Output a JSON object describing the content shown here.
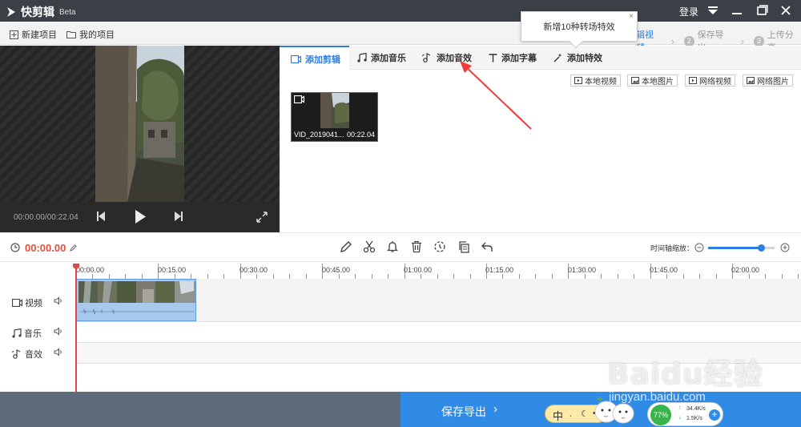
{
  "app": {
    "title": "快剪辑",
    "beta": "Beta",
    "login": "登录"
  },
  "menubar": {
    "new_project": "新建项目",
    "my_projects": "我的项目"
  },
  "steps": [
    {
      "num": "",
      "label": "辑视频"
    },
    {
      "num": "2",
      "label": "保存导出"
    },
    {
      "num": "3",
      "label": "上传分享"
    }
  ],
  "tooltip": {
    "text": "新增10种转场特效",
    "close": "×"
  },
  "preview": {
    "time": "00:00.00/00:22.04"
  },
  "tabs": [
    "添加剪辑",
    "添加音乐",
    "添加音效",
    "添加字幕",
    "添加特效"
  ],
  "sources": [
    "本地视频",
    "本地图片",
    "网络视频",
    "网络图片"
  ],
  "media": {
    "name": "VID_2019041...",
    "duration": "00:22.04"
  },
  "toolbar": {
    "current_time": "00:00.00",
    "zoom_label": "时间轴缩放：",
    "zoom_level": 0.8
  },
  "ruler": [
    "00:00.00",
    "00:15.00",
    "00:30.00",
    "00:45.00",
    "01:00.00",
    "01:15.00",
    "01:30.00",
    "01:45.00",
    "02:00.00"
  ],
  "tracks": [
    "视频",
    "音乐",
    "音效"
  ],
  "export": {
    "label": "保存导出",
    "chevron": "›"
  },
  "ime": {
    "lang": "中"
  },
  "net": {
    "percent": "77%",
    "up": "34.4K/s",
    "down": "1.5K/s"
  },
  "watermark": {
    "logo": "Baidu经验",
    "url": "jingyan.baidu.com"
  },
  "colors": {
    "accent": "#2b7de1",
    "time_red": "#e84c3d",
    "export_blue": "#2f8be6"
  }
}
